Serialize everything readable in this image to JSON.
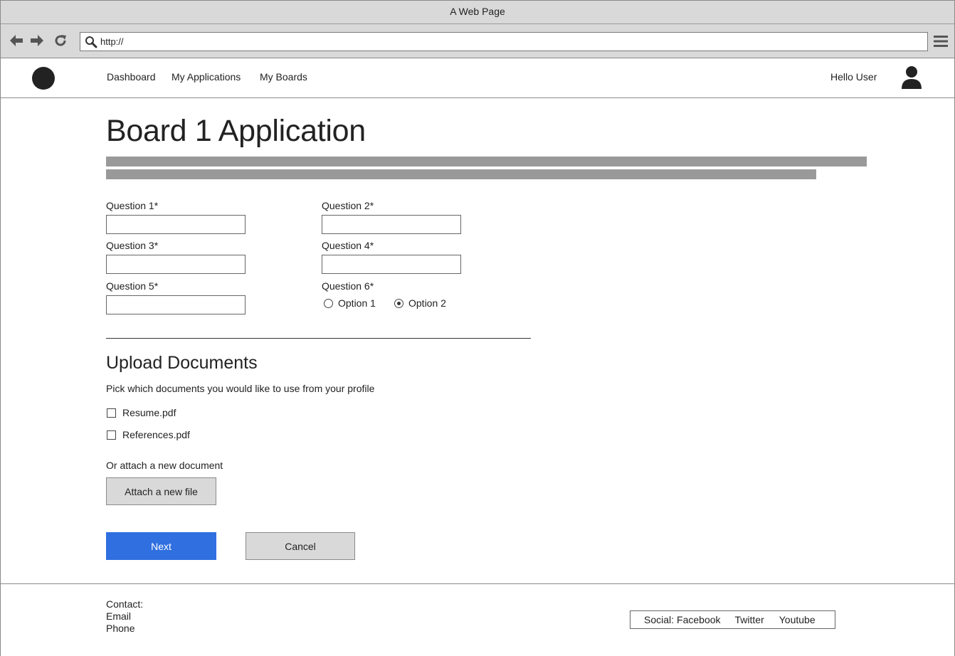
{
  "window": {
    "title": "A Web Page"
  },
  "browser": {
    "url": "http://"
  },
  "header": {
    "nav": [
      "Dashboard",
      "My Applications",
      "My Boards"
    ],
    "greeting": "Hello User"
  },
  "page": {
    "title": "Board 1 Application",
    "questions": [
      {
        "label": "Question 1*",
        "value": ""
      },
      {
        "label": "Question 2*",
        "value": ""
      },
      {
        "label": "Question 3*",
        "value": ""
      },
      {
        "label": "Question 4*",
        "value": ""
      },
      {
        "label": "Question 5*",
        "value": ""
      }
    ],
    "question6": {
      "label": "Question 6*",
      "options": [
        "Option 1",
        "Option 2"
      ],
      "selected": "Option 2"
    }
  },
  "upload": {
    "title": "Upload Documents",
    "description": "Pick which documents you would like to use from your profile",
    "documents": [
      {
        "name": "Resume.pdf",
        "checked": false
      },
      {
        "name": "References.pdf",
        "checked": false
      }
    ],
    "attach_label": "Or attach a new document",
    "attach_button": "Attach a new file"
  },
  "actions": {
    "next": "Next",
    "cancel": "Cancel"
  },
  "footer": {
    "contact": [
      "Contact:",
      "Email",
      "Phone"
    ],
    "social_label": "Social:",
    "social_links": [
      "Facebook",
      "Twitter",
      "Youtube"
    ]
  },
  "colors": {
    "primary_button": "#2f6fe0",
    "chrome": "#d9d9d9",
    "placeholder_bar": "#999999"
  }
}
